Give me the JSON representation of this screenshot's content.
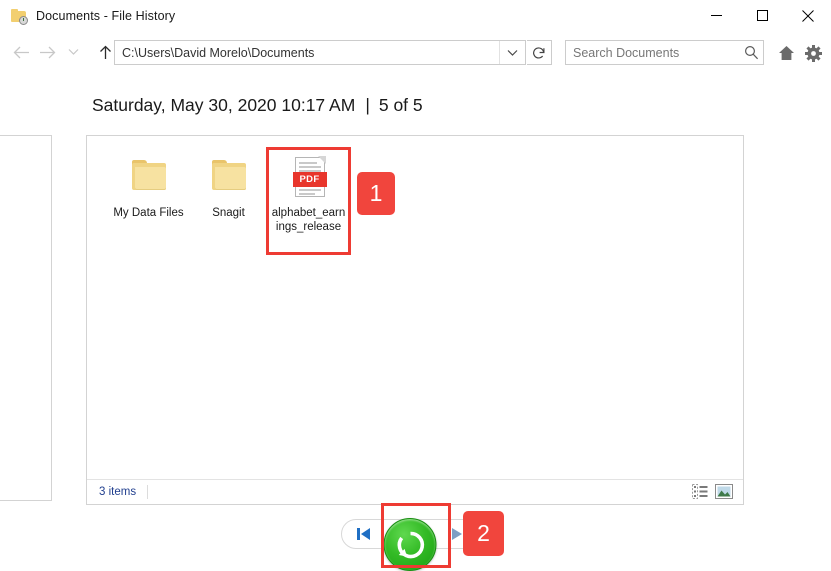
{
  "window": {
    "title": "Documents - File History",
    "title_icon": "file-history-folder-icon",
    "controls": {
      "minimize": "minimize-icon",
      "maximize": "maximize-icon",
      "close": "close-icon"
    }
  },
  "toolbar": {
    "back": "back-arrow-icon",
    "forward": "forward-arrow-icon",
    "recent": "chevron-down-icon",
    "up": "up-arrow-icon",
    "address_value": "C:\\Users\\David Morelo\\Documents",
    "address_dropdown": "chevron-down-icon",
    "refresh": "refresh-icon",
    "search_placeholder": "Search Documents",
    "search_value": "",
    "search_icon": "search-icon",
    "home_icon": "home-icon",
    "settings_icon": "gear-icon"
  },
  "header": {
    "timestamp": "Saturday, May 30, 2020 10:17 AM",
    "separator": "|",
    "version": "5 of 5"
  },
  "files": [
    {
      "name": "My Data Files",
      "type": "folder",
      "selected": false
    },
    {
      "name": "Snagit",
      "type": "folder",
      "selected": false
    },
    {
      "name": "alphabet_earnings_release",
      "type": "pdf",
      "selected": true,
      "icon_label": "PDF"
    }
  ],
  "status": {
    "item_count": "3 items",
    "view_details_icon": "details-view-icon",
    "view_thumbnails_icon": "large-icons-view-icon"
  },
  "navigation": {
    "previous_label": "previous-version-icon",
    "next_label": "next-version-icon",
    "restore_label": "restore-icon"
  },
  "callouts": [
    {
      "number": "1",
      "target": "selected-file"
    },
    {
      "number": "2",
      "target": "restore-button"
    }
  ],
  "colors": {
    "callout_red": "#f1453d",
    "highlight_red": "#ee3b33",
    "restore_green": "#34bb26",
    "status_blue": "#22408f",
    "pdf_red": "#e8362c",
    "folder_yellow": "#f0d484"
  }
}
